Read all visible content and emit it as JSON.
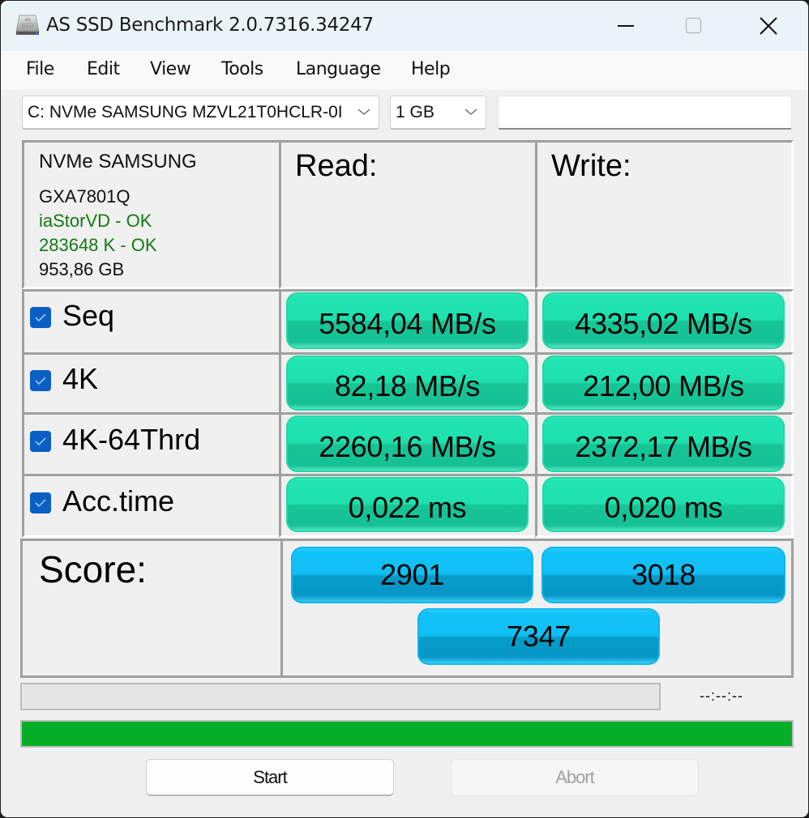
{
  "window": {
    "title": "AS SSD Benchmark 2.0.7316.34247",
    "controls": {
      "minimize": "minimize-icon",
      "maximize": "maximize-icon",
      "close": "close-icon"
    }
  },
  "menu": {
    "items": [
      "File",
      "Edit",
      "View",
      "Tools",
      "Language",
      "Help"
    ]
  },
  "toolbar": {
    "drive_select": "C: NVMe SAMSUNG MZVL21T0HCLR-0I",
    "size_select": "1 GB",
    "extra_field_value": ""
  },
  "drive_info": {
    "model": "NVMe SAMSUNG",
    "firmware": "GXA7801Q",
    "driver_status": "iaStorVD - OK",
    "alignment_status": "283648 K - OK",
    "capacity": "953,86 GB",
    "ok_color": "#127a12"
  },
  "results": {
    "read_header": "Read:",
    "write_header": "Write:",
    "rows": [
      {
        "label": "Seq",
        "checked": true,
        "read": "5584,04 MB/s",
        "write": "4335,02 MB/s"
      },
      {
        "label": "4K",
        "checked": true,
        "read": "82,18 MB/s",
        "write": "212,00 MB/s"
      },
      {
        "label": "4K-64Thrd",
        "checked": true,
        "read": "2260,16 MB/s",
        "write": "2372,17 MB/s"
      },
      {
        "label": "Acc.time",
        "checked": true,
        "read": "0,022 ms",
        "write": "0,020 ms"
      }
    ],
    "result_color": "#1ee0ad"
  },
  "score": {
    "label": "Score:",
    "read": "2901",
    "write": "3018",
    "total": "7347",
    "score_color": "#10bff5"
  },
  "status": {
    "progress_fraction": 0,
    "timer": "--:--:--",
    "overall_progress_fraction": 1,
    "progress_color": "#06ae27"
  },
  "buttons": {
    "start": "Start",
    "abort": "Abort"
  }
}
